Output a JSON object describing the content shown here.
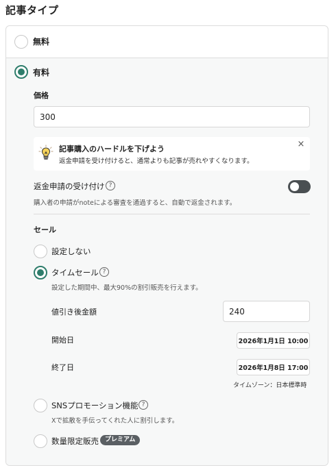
{
  "section_title": "記事タイプ",
  "options": {
    "free_label": "無料",
    "paid_label": "有料"
  },
  "price": {
    "label": "価格",
    "value": "300"
  },
  "tip": {
    "title": "記事購入のハードルを下げよう",
    "body": "返金申請を受け付けると、通常よりも記事が売れやすくなります。",
    "close": "×"
  },
  "refund": {
    "label": "返金申請の受け付け",
    "help": "購入者の申請がnoteによる審査を通過すると、自動で返金されます。",
    "enabled": false
  },
  "sale": {
    "heading": "セール",
    "none_label": "設定しない",
    "timesale_label": "タイムセール",
    "timesale_desc": "設定した期間中、最大90%の割引販売を行えます。",
    "discount_label": "値引き後金額",
    "discount_value": "240",
    "start_label": "開始日",
    "start_value": "2026年1月1日 10:00",
    "end_label": "終了日",
    "end_value": "2026年1月8日 17:00",
    "timezone": "タイムゾーン：日本標準時",
    "sns_label": "SNSプロモーション機能",
    "sns_desc": "Xで拡散を手伝ってくれた人に割引します。",
    "limited_label": "数量限定販売",
    "premium_badge": "プレミアム"
  },
  "selected": {
    "type": "paid",
    "sale": "timesale"
  },
  "colors": {
    "accent": "#2e7d6b",
    "toggle_off": "#4a4f52",
    "badge": "#5a5f63"
  },
  "icons": {
    "help": "question-circle-icon",
    "tip": "lightbulb-icon",
    "close": "close-icon"
  }
}
